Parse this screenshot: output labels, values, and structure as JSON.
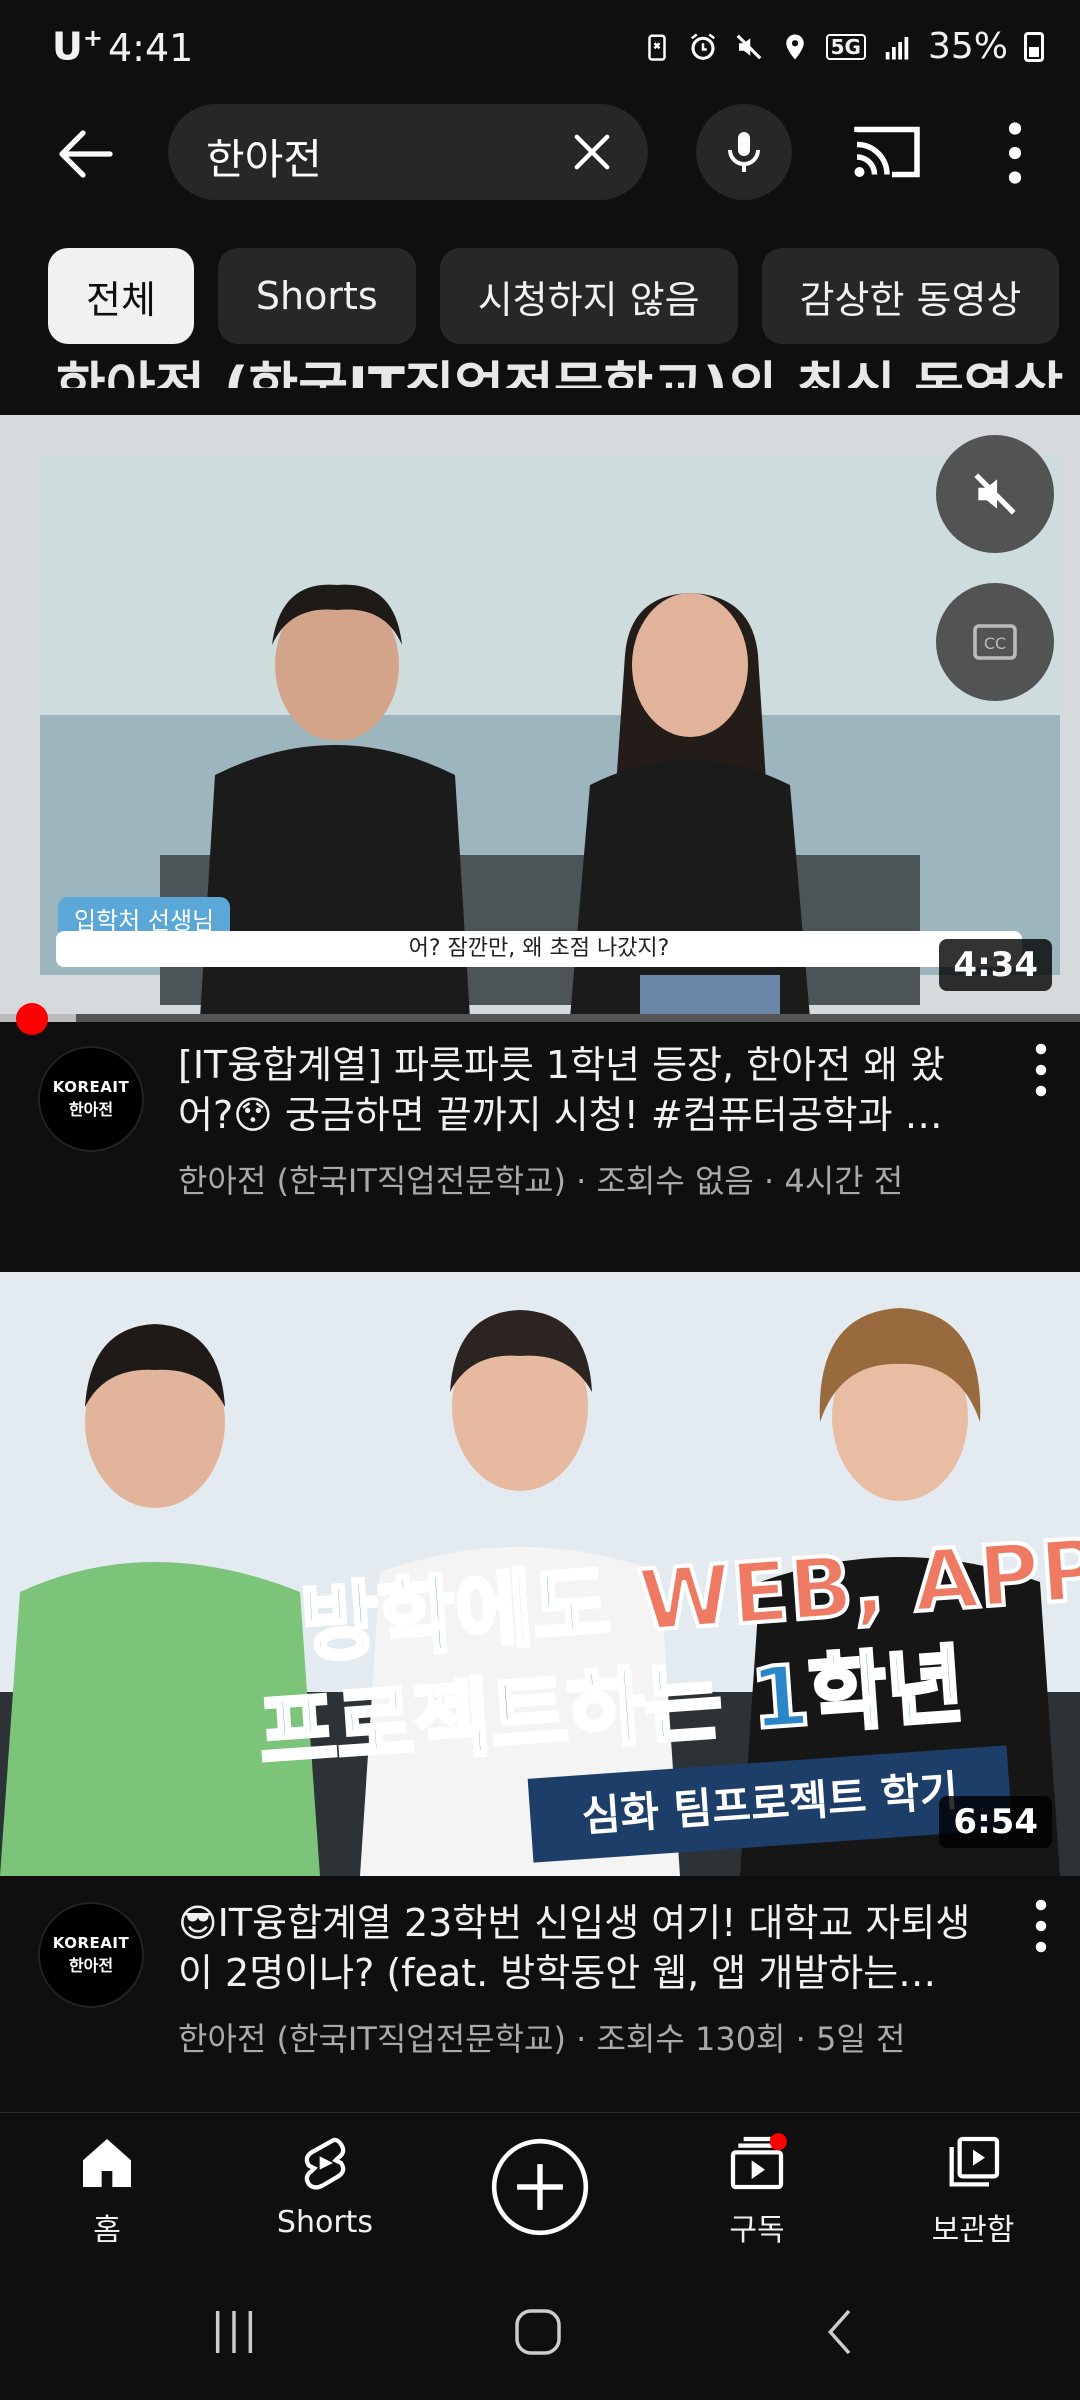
{
  "status_bar": {
    "carrier": "U",
    "carrier_sup": "+",
    "time": "4:41",
    "network": "5G",
    "battery": "35%"
  },
  "search": {
    "query": "한아전"
  },
  "chips": [
    "전체",
    "Shorts",
    "시청하지 않음",
    "감상한 동영상"
  ],
  "partial_title": "한아전 (한국IT직업전문학교)의 최신 동영상",
  "videos": [
    {
      "overlay_tag": "입학처 선생님",
      "subtitle": "어? 잠깐만, 왜 초점 나갔지?",
      "duration": "4:34",
      "title": "[IT융합계열] 파릇파릇 1학년 등장, 한아전 왜 왔어?😯 궁금하면 끝까지 시청! #컴퓨터공학과 …",
      "meta": "한아전 (한국IT직업전문학교) · 조회수 없음 · 4시간 전",
      "avatar_line1": "KOREAIT",
      "avatar_line2": "한아전",
      "progress": 0.07
    },
    {
      "banner_line1_a": "방학에도",
      "banner_line1_b": "WEB, APP",
      "banner_line2": "프로젝트하는 1학년",
      "banner_line3": "심화 팀프로젝트 학기",
      "duration": "6:54",
      "title": "😎IT융합계열 23학번 신입생 여기! 대학교 자퇴생이 2명이나? (feat. 방학동안 웹, 앱 개발하는…",
      "meta": "한아전 (한국IT직업전문학교) · 조회수 130회 · 5일 전",
      "avatar_line1": "KOREAIT",
      "avatar_line2": "한아전"
    }
  ],
  "bottom_nav": {
    "home": "홈",
    "shorts": "Shorts",
    "subscriptions": "구독",
    "library": "보관함"
  },
  "colors": {
    "background": "#0f0f0f",
    "chip": "#272727",
    "accent_red": "#ff0000",
    "meta_text": "#aaaaaa"
  }
}
